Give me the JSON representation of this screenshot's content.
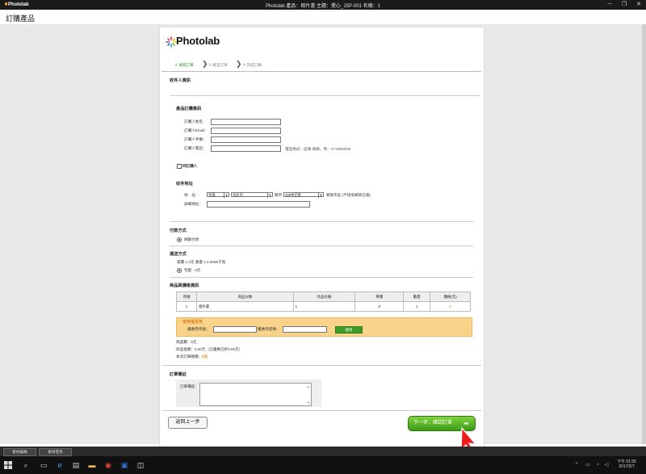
{
  "window": {
    "app_logo": "Photolab",
    "title": "Photolab     產品：相片書   主題：愛心_15P-001   名稱：1",
    "controls": [
      "─",
      "❐",
      "✕"
    ]
  },
  "page": {
    "title": "訂購產品"
  },
  "brand": {
    "name": "Photolab",
    "accent": "#f6a821"
  },
  "steps": [
    {
      "label": "① 填寫訂單",
      "active": true
    },
    {
      "label": "② 確定訂單",
      "active": false
    },
    {
      "label": "③ 完成訂購",
      "active": false
    }
  ],
  "recipient": {
    "section_title": "收件人資訊",
    "order_info_title": "產品訂購資訊",
    "fields": [
      {
        "label": "訂購人姓名：",
        "value": ""
      },
      {
        "label": "訂購人Email：",
        "value": ""
      },
      {
        "label": "訂購人手機：",
        "value": ""
      },
      {
        "label": "訂購人電話：",
        "value": ""
      }
    ],
    "phone_hint": "電話格式：區碼-號碼，例：07-0000000",
    "same_person_label": "同訂購人"
  },
  "address": {
    "title": "收件地址",
    "region_label": "地　址：",
    "country": "台灣",
    "city": "台北市",
    "district_label": "縣市",
    "district": "100中正區",
    "district_hint": "鄉鎮市區 (不接受郵政信箱)",
    "detail_label": "詳細地址："
  },
  "payment": {
    "title": "付款方式",
    "option": "網路付款"
  },
  "shipping": {
    "title": "運送方式",
    "summary": "運費 1 0元  重量 1 0.0000千克",
    "option": "宅配 - 0元"
  },
  "products": {
    "title": "商品與價格資訊",
    "headers": [
      "序號",
      "商品分類",
      "作品名稱",
      "單價",
      "數量",
      "價格(元)"
    ],
    "rows": [
      {
        "no": "1",
        "category": "相片書",
        "name": "1",
        "price": "0",
        "qty": "1",
        "total": "0"
      }
    ]
  },
  "coupon": {
    "title": "使用優惠券",
    "code_label": "優惠券序號：",
    "password_label": "優惠券密碼：",
    "apply": "使用"
  },
  "totals": {
    "shipping": "快遞費：0元",
    "product": "商品金額：0.00元（已優惠已折0.00元）",
    "order_label": "本次訂單總價：",
    "order_value": "0元"
  },
  "notes": {
    "title": "訂單備註",
    "label": "訂單備註："
  },
  "buttons": {
    "back": "返回上一步",
    "next": "下一步，確認訂單"
  },
  "bottom_tabs": [
    "素材編輯",
    "素材首頁"
  ],
  "clock": {
    "time": "下午 01:55",
    "date": "2017/2/7"
  }
}
